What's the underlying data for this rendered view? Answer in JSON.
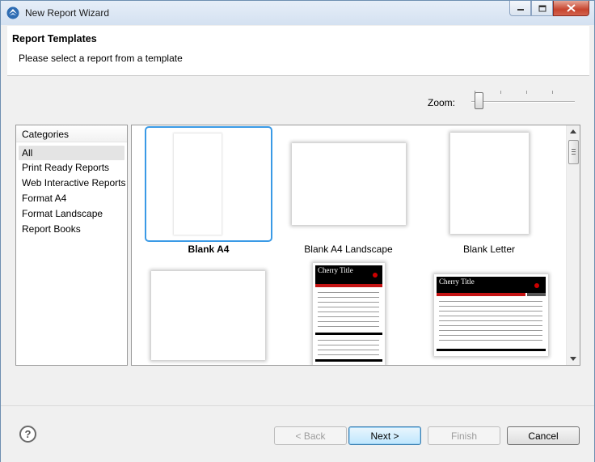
{
  "window": {
    "title": "New Report Wizard"
  },
  "header": {
    "title": "Report Templates",
    "description": "Please select a report from a template"
  },
  "zoom": {
    "label": "Zoom:"
  },
  "categories": {
    "header": "Categories",
    "items": [
      "All",
      "Print Ready Reports",
      "Web Interactive Reports",
      "Format A4",
      "Format Landscape",
      "Report Books"
    ],
    "selected": "All"
  },
  "templates": {
    "items": [
      {
        "label": "Blank A4",
        "selected": true
      },
      {
        "label": "Blank A4 Landscape"
      },
      {
        "label": "Blank Letter"
      },
      {
        "label": ""
      },
      {
        "label": "",
        "preview_title": "Cherry Title"
      },
      {
        "label": "",
        "preview_title": "Cherry Title"
      }
    ]
  },
  "buttons": {
    "back": "< Back",
    "next": "Next >",
    "finish": "Finish",
    "cancel": "Cancel",
    "help": "?"
  },
  "colors": {
    "selection": "#3a9ae6",
    "default_button": "#3c7fb1",
    "cherry_red": "#c41414"
  }
}
